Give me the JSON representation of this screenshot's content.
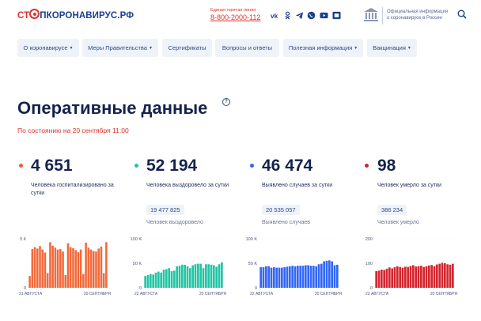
{
  "header": {
    "logo_left": "СТ",
    "logo_right": "ПКОРОНАВИРУС.РФ",
    "hotline_caption": "Единая горячая линия",
    "hotline_number": "8-800-2000-112",
    "social_icons": [
      "vk-icon",
      "odnoklassniki-icon",
      "telegram-icon",
      "viber-icon",
      "youtube-icon",
      "rutube-icon"
    ],
    "official_info": "Официальная информация о коронавирусе в России"
  },
  "nav": {
    "items": [
      {
        "label": "О коронавирусе",
        "dropdown": true
      },
      {
        "label": "Меры Правительства",
        "dropdown": true
      },
      {
        "label": "Сертификаты",
        "dropdown": false
      },
      {
        "label": "Вопросы и ответы",
        "dropdown": false
      },
      {
        "label": "Полезная информация",
        "dropdown": true
      },
      {
        "label": "Вакцинация",
        "dropdown": true
      }
    ]
  },
  "page": {
    "title": "Оперативные данные",
    "help_icon": "?",
    "subtitle": "По состоянию на 20 сентября 11:00"
  },
  "stats": [
    {
      "value": "4 651",
      "label": "Человека госпитализировано за сутки",
      "color": "#f05a3c"
    },
    {
      "value": "52 194",
      "label": "Человека выздоровело за сутки",
      "total": "19 477 825",
      "total_label": "Человек выздоровело",
      "color": "#1fc6a5"
    },
    {
      "value": "46 474",
      "label": "Выявлено случаев за сутки",
      "total": "20 535 057",
      "total_label": "Выявлено случаев",
      "color": "#3266f5"
    },
    {
      "value": "98",
      "label": "Человек умерло за сутки",
      "total": "386 234",
      "total_label": "Человек умерло",
      "color": "#d3262f"
    }
  ],
  "chart_data": [
    {
      "type": "bar",
      "name_hint": "hospitalized",
      "color": "#f26a3c",
      "yticks": [
        "5 К",
        "0"
      ],
      "ylim": [
        0,
        5000
      ],
      "xstart": "21 АВГУСТА",
      "xend": "20 СЕНТЯБРЯ",
      "values": [
        1200,
        3950,
        4150,
        4000,
        4250,
        3900,
        3600,
        1500,
        4650,
        4300,
        4100,
        3900,
        3950,
        3700,
        1300,
        4550,
        4150,
        4050,
        3850,
        3650,
        3900,
        1400,
        4600,
        4100,
        3900,
        3750,
        3700,
        4000,
        4200,
        1500,
        4650
      ]
    },
    {
      "type": "bar",
      "name_hint": "recovered",
      "color": "#1fc6a5",
      "yticks": [
        "100 K",
        "50 K",
        "0"
      ],
      "ylim": [
        0,
        100000
      ],
      "xstart": "22 АВГУСТА",
      "xend": "20 СЕНТЯБРЯ",
      "values": [
        24000,
        26000,
        28000,
        27000,
        31000,
        33000,
        31000,
        37000,
        38000,
        40000,
        34000,
        35000,
        44000,
        45000,
        47000,
        47000,
        44000,
        40000,
        46000,
        48000,
        49000,
        49000,
        40000,
        48000,
        48000,
        47000,
        46000,
        43000,
        48000,
        52000
      ]
    },
    {
      "type": "bar",
      "name_hint": "cases",
      "color": "#3266f5",
      "yticks": [
        "100 K",
        "50 K",
        "0"
      ],
      "ylim": [
        0,
        100000
      ],
      "xstart": "22 АВГУСТА",
      "xend": "20 СЕНТЯБРЯ",
      "values": [
        42000,
        42000,
        44000,
        44000,
        41000,
        42000,
        41000,
        41000,
        41000,
        42000,
        43000,
        44000,
        45000,
        44000,
        45000,
        45000,
        45000,
        46000,
        46000,
        45000,
        45000,
        44000,
        48000,
        49000,
        54000,
        55000,
        56000,
        54000,
        46000,
        47000
      ]
    },
    {
      "type": "bar",
      "name_hint": "deaths",
      "color": "#d3262f",
      "yticks": [
        "200",
        "100",
        "0"
      ],
      "ylim": [
        0,
        200
      ],
      "xstart": "22 АВГУСТА",
      "xend": "20 СЕНТЯБРЯ",
      "values": [
        68,
        70,
        74,
        73,
        78,
        83,
        79,
        84,
        88,
        85,
        82,
        86,
        85,
        89,
        92,
        87,
        88,
        90,
        85,
        88,
        91,
        93,
        88,
        95,
        98,
        102,
        100,
        96,
        94,
        98
      ]
    }
  ]
}
